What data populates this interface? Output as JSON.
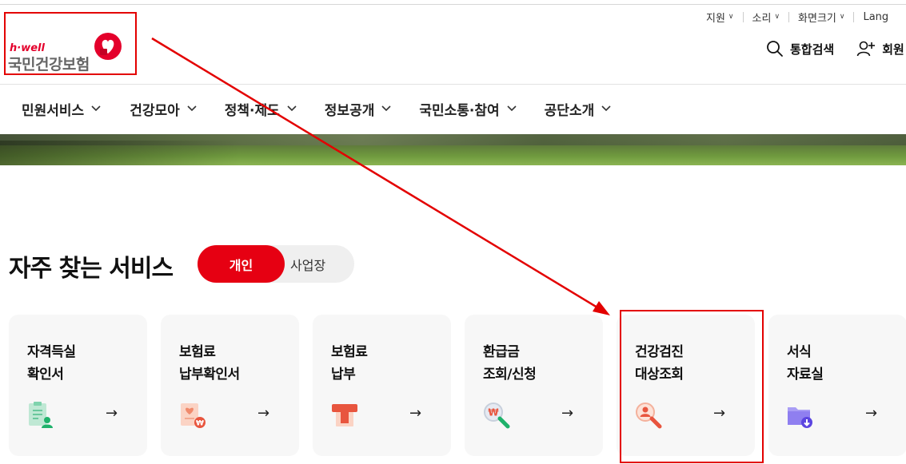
{
  "utility_nav": [
    {
      "label": "지원"
    },
    {
      "label": "소리"
    },
    {
      "label": "화면크기"
    },
    {
      "label": "Lang"
    }
  ],
  "logo": {
    "tagline": "h·well",
    "name": "국민건강보험"
  },
  "header_actions": {
    "search_label": "통합검색",
    "member_label": "회원"
  },
  "main_nav": [
    {
      "label": "민원서비스"
    },
    {
      "label": "건강모아"
    },
    {
      "label": "정책·제도"
    },
    {
      "label": "정보공개"
    },
    {
      "label": "국민소통·참여"
    },
    {
      "label": "공단소개"
    }
  ],
  "services": {
    "title": "자주 찾는 서비스",
    "tabs": {
      "personal": "개인",
      "business": "사업장",
      "active": "personal"
    },
    "cards": [
      {
        "line1": "자격득실",
        "line2": "확인서",
        "icon": "certificate-icon",
        "arrow": "→"
      },
      {
        "line1": "보험료",
        "line2": "납부확인서",
        "icon": "payment-receipt-icon",
        "arrow": "→"
      },
      {
        "line1": "보험료",
        "line2": "납부",
        "icon": "card-payment-icon",
        "arrow": "→"
      },
      {
        "line1": "환급금",
        "line2": "조회/신청",
        "icon": "refund-search-icon",
        "arrow": "→"
      },
      {
        "line1": "건강검진",
        "line2": "대상조회",
        "icon": "checkup-search-icon",
        "arrow": "→"
      },
      {
        "line1": "서식",
        "line2": "자료실",
        "icon": "folder-download-icon",
        "arrow": "→"
      }
    ]
  },
  "colors": {
    "brand_red": "#e60012",
    "annotation_red": "#e30000"
  }
}
